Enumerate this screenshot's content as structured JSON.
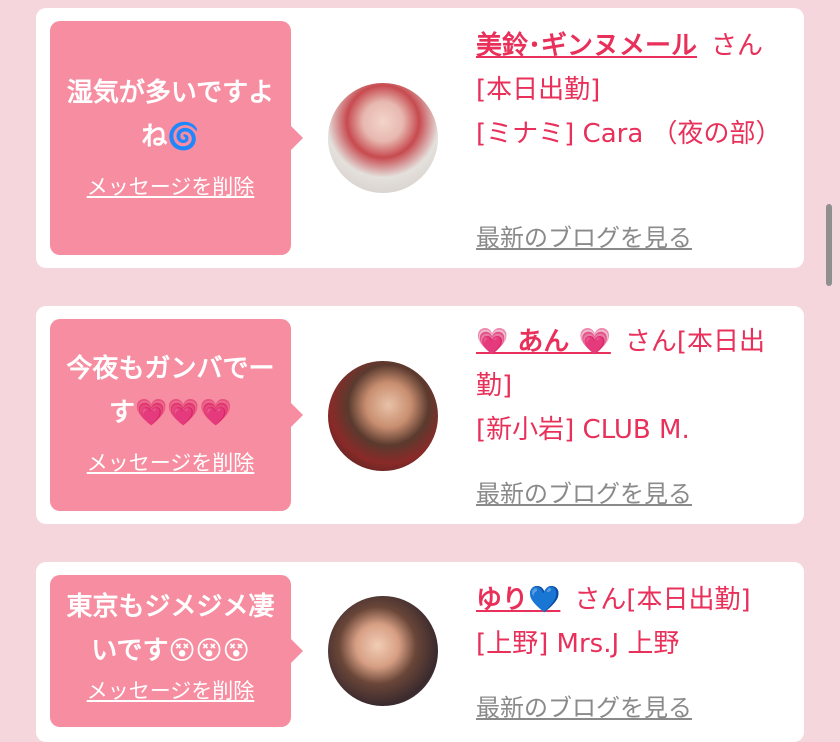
{
  "messages": [
    {
      "text": "湿気が多いですよね🌀",
      "delete_label": "メッセージを削除",
      "name": "美鈴･ギンヌメール",
      "suffix": "さん[本日出勤]",
      "shop": "[ミナミ] Cara （夜の部）",
      "blog_label": "最新のブログを見る"
    },
    {
      "text": "今夜もガンバでーす💗💗💗",
      "delete_label": "メッセージを削除",
      "name": "💗 あん 💗",
      "suffix": "さん[本日出勤]",
      "shop": "[新小岩] CLUB M.",
      "blog_label": "最新のブログを見る"
    },
    {
      "text": "東京もジメジメ凄いです😵😵😵",
      "delete_label": "メッセージを削除",
      "name": "ゆり💙",
      "suffix": "さん[本日出勤]",
      "shop": "[上野] Mrs.J 上野",
      "blog_label": "最新のブログを見る"
    }
  ]
}
